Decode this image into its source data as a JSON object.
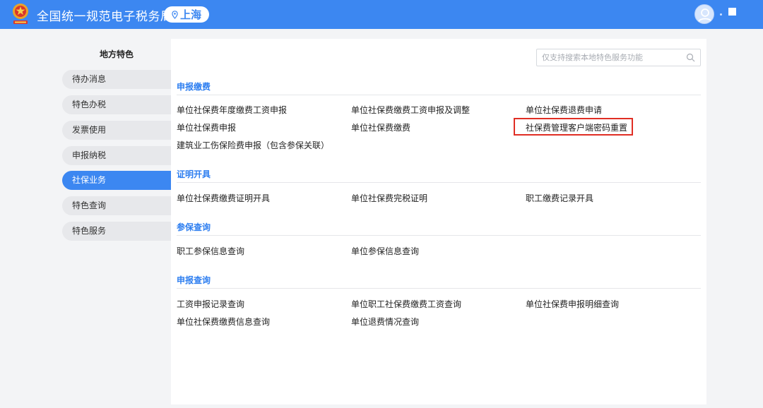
{
  "header": {
    "title": "全国统一规范电子税务局",
    "region": "上海",
    "region_icon": "location-pin-icon",
    "avatar_icon": "user-avatar-icon",
    "colors": {
      "brand": "#3c87f1",
      "accent_text": "#2d7ef0",
      "highlight": "#e02e24"
    }
  },
  "sidebar": {
    "heading": "地方特色",
    "items": [
      {
        "label": "待办消息",
        "active": false
      },
      {
        "label": "特色办税",
        "active": false
      },
      {
        "label": "发票使用",
        "active": false
      },
      {
        "label": "申报纳税",
        "active": false
      },
      {
        "label": "社保业务",
        "active": true
      },
      {
        "label": "特色查询",
        "active": false
      },
      {
        "label": "特色服务",
        "active": false
      }
    ]
  },
  "search": {
    "placeholder": "仅支持搜索本地特色服务功能",
    "value": "",
    "icon": "search-icon"
  },
  "sections": [
    {
      "title": "申报缴费",
      "links": [
        "单位社保费年度缴费工资申报",
        "单位社保费缴费工资申报及调整",
        "单位社保费退费申请",
        "单位社保费申报",
        "单位社保费缴费",
        "社保费管理客户端密码重置",
        "建筑业工伤保险费申报（包含参保关联）"
      ]
    },
    {
      "title": "证明开具",
      "links": [
        "单位社保费缴费证明开具",
        "单位社保费完税证明",
        "职工缴费记录开具"
      ]
    },
    {
      "title": "参保查询",
      "links": [
        "职工参保信息查询",
        "单位参保信息查询"
      ]
    },
    {
      "title": "申报查询",
      "links": [
        "工资申报记录查询",
        "单位职工社保费缴费工资查询",
        "单位社保费申报明细查询",
        "单位社保费缴费信息查询",
        "单位退费情况查询"
      ]
    }
  ],
  "highlighted_link": "社保费管理客户端密码重置"
}
